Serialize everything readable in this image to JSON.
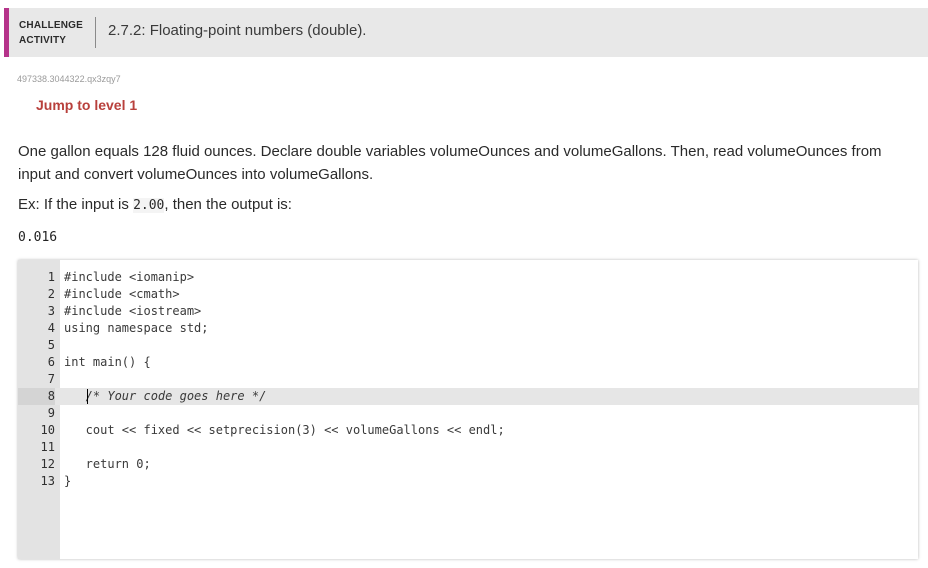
{
  "header": {
    "tag_line1": "CHALLENGE",
    "tag_line2": "ACTIVITY",
    "title": "2.7.2: Floating-point numbers (double).",
    "accent_color": "#b5338a"
  },
  "activity_id": "497338.3044322.qx3zqy7",
  "jump_label": "Jump to level 1",
  "jump_color": "#b8403c",
  "description": "One gallon equals 128 fluid ounces. Declare double variables volumeOunces and volumeGallons. Then, read volumeOunces from input and convert volumeOunces into volumeGallons.",
  "example": {
    "prefix": "Ex: If the input is ",
    "input": "2.00",
    "suffix": ", then the output is:",
    "output": "0.016"
  },
  "editor": {
    "lines": [
      {
        "num": "1",
        "code": "#include <iomanip>"
      },
      {
        "num": "2",
        "code": "#include <cmath>"
      },
      {
        "num": "3",
        "code": "#include <iostream>"
      },
      {
        "num": "4",
        "code": "using namespace std;"
      },
      {
        "num": "5",
        "code": ""
      },
      {
        "num": "6",
        "code": "int main() {"
      },
      {
        "num": "7",
        "code": ""
      },
      {
        "num": "8",
        "code": "   /* Your code goes here */"
      },
      {
        "num": "9",
        "code": ""
      },
      {
        "num": "10",
        "code": "   cout << fixed << setprecision(3) << volumeGallons << endl;"
      },
      {
        "num": "11",
        "code": ""
      },
      {
        "num": "12",
        "code": "   return 0;"
      },
      {
        "num": "13",
        "code": "}"
      }
    ]
  }
}
